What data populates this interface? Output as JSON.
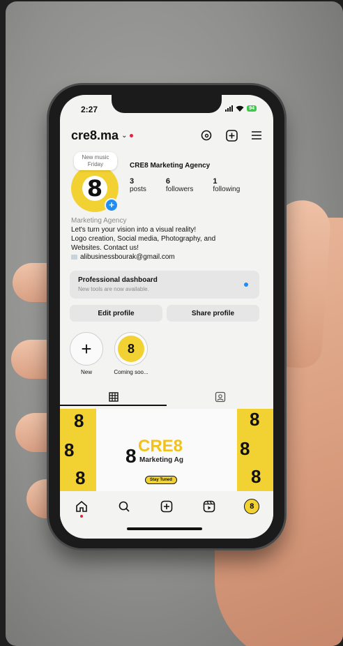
{
  "status_bar": {
    "time": "2:27",
    "battery": "94"
  },
  "header": {
    "username": "cre8.ma",
    "icons": [
      "threads-icon",
      "add-post-icon",
      "menu-icon"
    ]
  },
  "profile": {
    "note": "New music Friday",
    "avatar_text": "8",
    "display_name": "CRE8 Marketing Agency",
    "stats": [
      {
        "num": "3",
        "label": "posts"
      },
      {
        "num": "6",
        "label": "followers"
      },
      {
        "num": "1",
        "label": "following"
      }
    ],
    "category": "Marketing Agency",
    "bio_lines": [
      "Let's turn your vision into a visual reality!",
      "Logo creation, Social media, Photography, and",
      "Websites. Contact us!"
    ],
    "email": "alibusinessbourak@gmail.com"
  },
  "dashboard": {
    "title": "Professional dashboard",
    "subtitle": "New tools are now available."
  },
  "buttons": {
    "edit": "Edit profile",
    "share": "Share profile"
  },
  "highlights": [
    {
      "label": "New"
    },
    {
      "label": "Coming soo..."
    }
  ],
  "post": {
    "brand": "CRE8",
    "subtitle": "Marketing Ag",
    "pill": "Stay Tuned"
  },
  "colors": {
    "brand_yellow": "#f2d232",
    "accent_blue": "#1e8ef5",
    "notification_red": "#e0243b"
  }
}
